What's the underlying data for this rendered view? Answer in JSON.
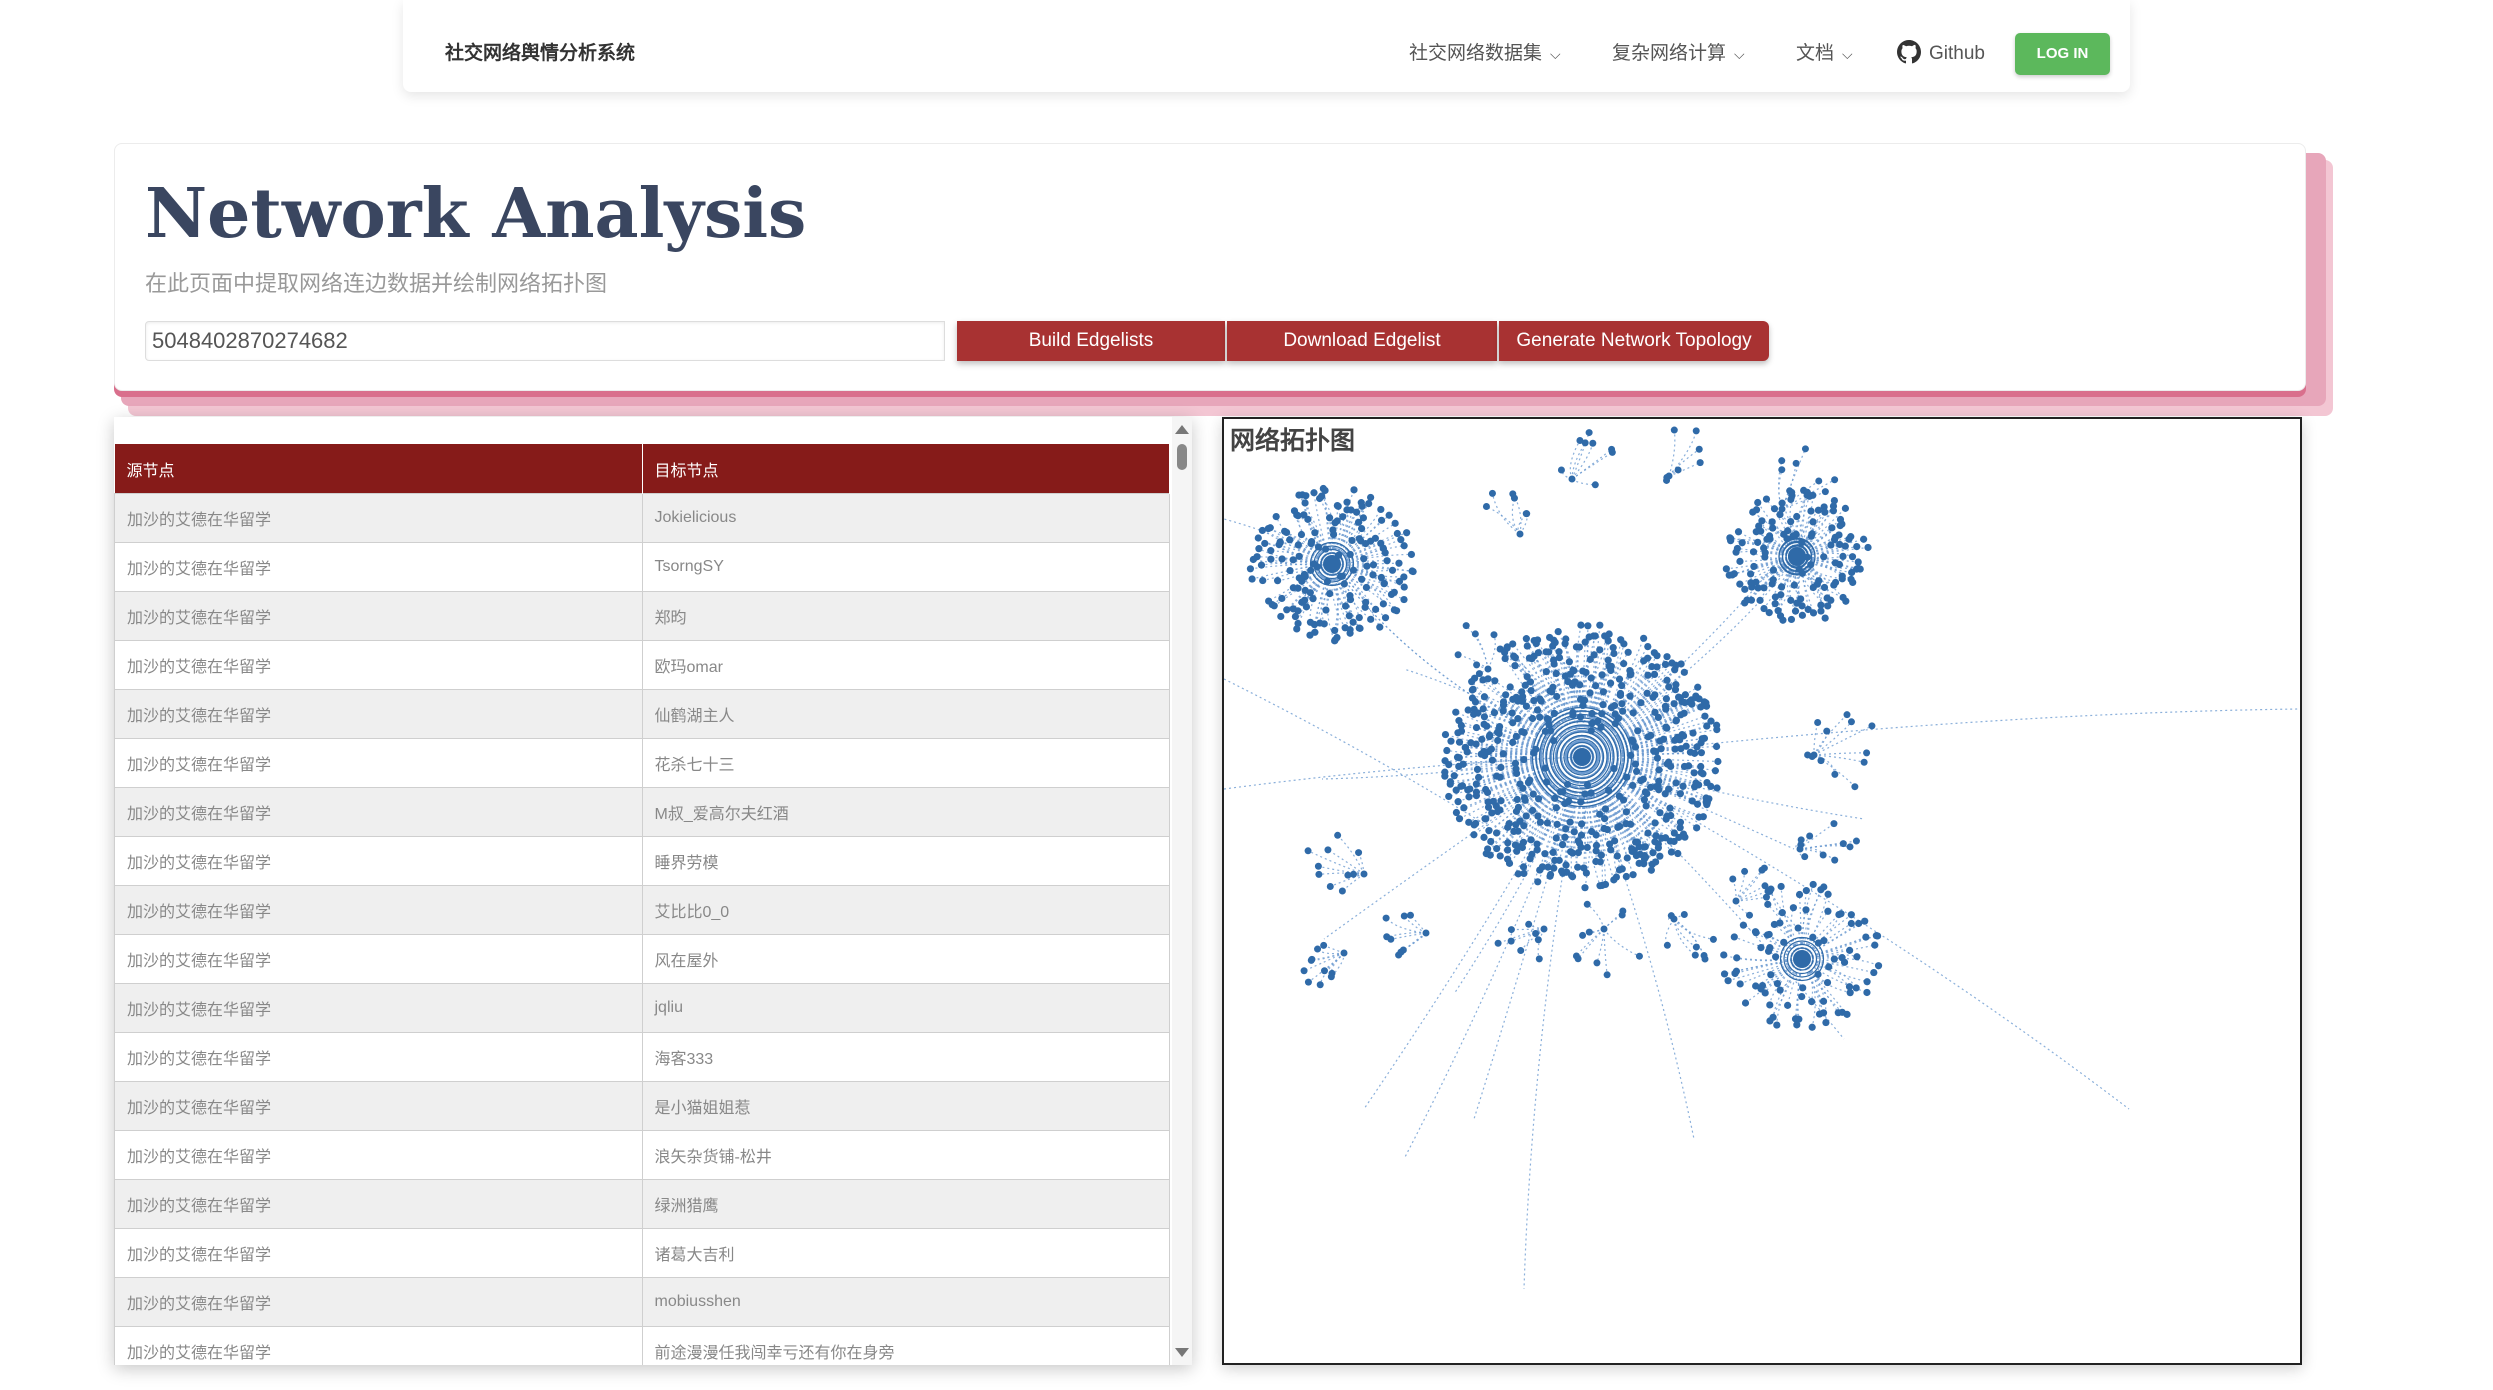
{
  "navbar": {
    "brand": "社交网络舆情分析系统",
    "items": [
      {
        "label": "社交网络数据集"
      },
      {
        "label": "复杂网络计算"
      },
      {
        "label": "文档"
      }
    ],
    "github_label": "Github",
    "login_label": "LOG IN"
  },
  "header": {
    "title": "Network Analysis",
    "subtitle": "在此页面中提取网络连边数据并绘制网络拓扑图",
    "input_value": "5048402870274682",
    "buttons": {
      "build": "Build Edgelists",
      "download": "Download Edgelist",
      "generate": "Generate Network Topology"
    }
  },
  "table": {
    "headers": [
      "源节点",
      "目标节点"
    ],
    "rows": [
      [
        "加沙的艾德在华留学",
        "Jokielicious"
      ],
      [
        "加沙的艾德在华留学",
        "TsorngSY"
      ],
      [
        "加沙的艾德在华留学",
        "郑昀"
      ],
      [
        "加沙的艾德在华留学",
        "欧玛omar"
      ],
      [
        "加沙的艾德在华留学",
        "仙鹤湖主人"
      ],
      [
        "加沙的艾德在华留学",
        "花杀七十三"
      ],
      [
        "加沙的艾德在华留学",
        "M叔_爱高尔夫红酒"
      ],
      [
        "加沙的艾德在华留学",
        "睡界劳模"
      ],
      [
        "加沙的艾德在华留学",
        "艾比比0_0"
      ],
      [
        "加沙的艾德在华留学",
        "风在屋外"
      ],
      [
        "加沙的艾德在华留学",
        "jqliu"
      ],
      [
        "加沙的艾德在华留学",
        "海客333"
      ],
      [
        "加沙的艾德在华留学",
        "是小猫姐姐惹"
      ],
      [
        "加沙的艾德在华留学",
        "浪矢杂货铺-松井"
      ],
      [
        "加沙的艾德在华留学",
        "绿洲猎鹰"
      ],
      [
        "加沙的艾德在华留学",
        "诸葛大吉利"
      ],
      [
        "加沙的艾德在华留学",
        "mobiusshen"
      ],
      [
        "加沙的艾德在华留学",
        "前途漫漫任我闯幸亏还有你在身旁"
      ]
    ]
  },
  "network": {
    "title": "网络拓扑图",
    "node_color": "#2f6aa8",
    "edge_color": "#6d9bd1"
  },
  "colors": {
    "primary": "#a83232",
    "table_header": "#861b19",
    "login": "#5cb85c",
    "title": "#3a4660"
  }
}
